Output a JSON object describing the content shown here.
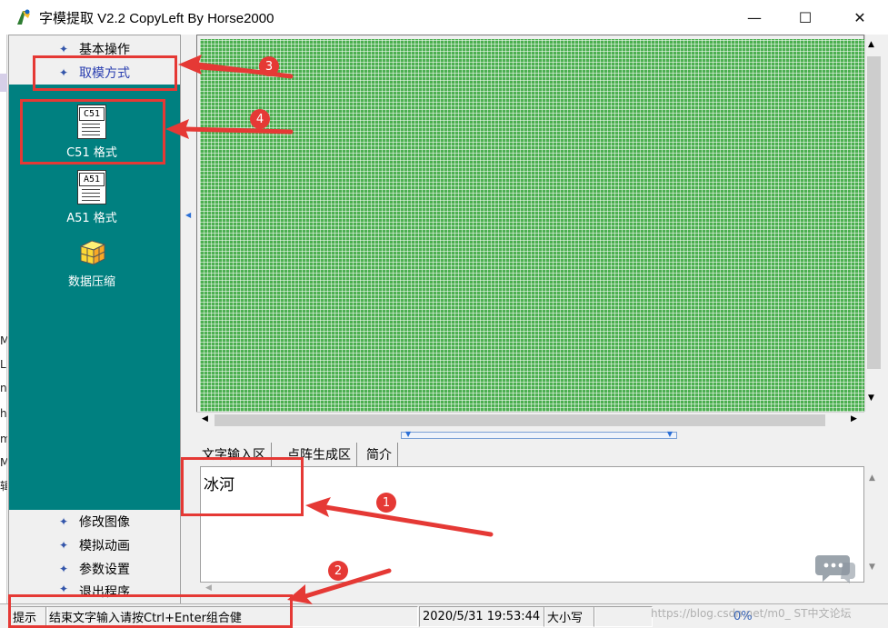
{
  "window": {
    "title": "字模提取 V2.2  CopyLeft By Horse2000",
    "minimize_glyph": "—",
    "maximize_glyph": "☐",
    "close_glyph": "✕"
  },
  "background_window_fragments": [
    "M",
    "L",
    "n",
    "h",
    "m",
    "M",
    "辑"
  ],
  "nav": {
    "top_sections": [
      {
        "label": "基本操作",
        "icon": "diamond-icon"
      },
      {
        "label": "取模方式",
        "icon": "diamond-icon"
      }
    ],
    "panel_items": [
      {
        "label": "C51 格式",
        "badge": "C51",
        "icon": "c51-document-icon"
      },
      {
        "label": "A51 格式",
        "badge": "A51",
        "icon": "a51-document-icon"
      },
      {
        "label": "数据压缩",
        "icon": "compress-cube-icon"
      }
    ],
    "bottom_sections": [
      {
        "label": "修改图像",
        "icon": "diamond-icon"
      },
      {
        "label": "模拟动画",
        "icon": "diamond-icon"
      },
      {
        "label": "参数设置",
        "icon": "diamond-icon"
      },
      {
        "label": "退出程序",
        "icon": "diamond-icon"
      }
    ]
  },
  "tabs": [
    {
      "label": "文字输入区",
      "active": true
    },
    {
      "label": "点阵生成区",
      "active": false
    },
    {
      "label": "简介",
      "active": false
    }
  ],
  "text_input": {
    "value": "冰河"
  },
  "status": {
    "hint_label": "提示",
    "hint_text": "结束文字输入请按Ctrl+Enter组合健",
    "datetime": "2020/5/31 19:53:44",
    "caps": "大小写",
    "percent": "0%"
  },
  "watermark": "https://blog.csdn.net/m0_    ST中文论坛",
  "annotations": [
    {
      "number": "1"
    },
    {
      "number": "2"
    },
    {
      "number": "3"
    },
    {
      "number": "4"
    }
  ],
  "colors": {
    "panel_teal": "#008080",
    "grid_green": "#4caf50",
    "annotation_red": "#e53935",
    "nav_diamond": "#3355aa"
  }
}
